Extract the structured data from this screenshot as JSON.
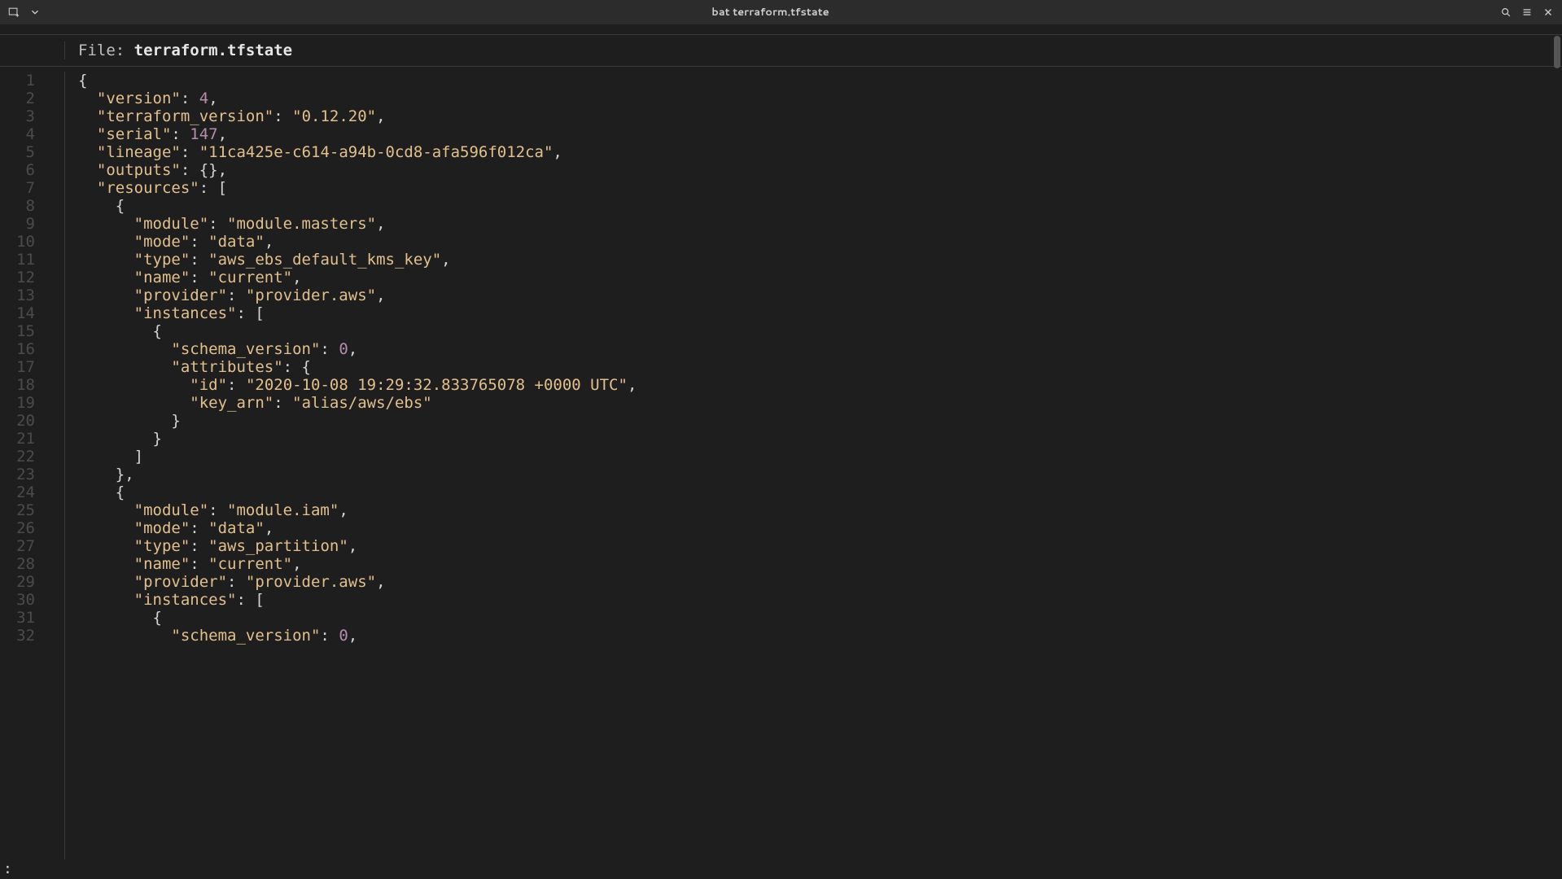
{
  "titlebar": {
    "title": "bat terraform.tfstate"
  },
  "file_header": {
    "prefix": "File: ",
    "filename": "terraform.tfstate"
  },
  "status": {
    "prompt": ":"
  },
  "code": {
    "lines": [
      {
        "n": 1,
        "tokens": [
          {
            "t": "{",
            "c": "p"
          }
        ]
      },
      {
        "n": 2,
        "tokens": [
          {
            "t": "  ",
            "c": "p"
          },
          {
            "t": "\"version\"",
            "c": "key"
          },
          {
            "t": ": ",
            "c": "p"
          },
          {
            "t": "4",
            "c": "num"
          },
          {
            "t": ",",
            "c": "p"
          }
        ]
      },
      {
        "n": 3,
        "tokens": [
          {
            "t": "  ",
            "c": "p"
          },
          {
            "t": "\"terraform_version\"",
            "c": "key"
          },
          {
            "t": ": ",
            "c": "p"
          },
          {
            "t": "\"0.12.20\"",
            "c": "str"
          },
          {
            "t": ",",
            "c": "p"
          }
        ]
      },
      {
        "n": 4,
        "tokens": [
          {
            "t": "  ",
            "c": "p"
          },
          {
            "t": "\"serial\"",
            "c": "key"
          },
          {
            "t": ": ",
            "c": "p"
          },
          {
            "t": "147",
            "c": "num"
          },
          {
            "t": ",",
            "c": "p"
          }
        ]
      },
      {
        "n": 5,
        "tokens": [
          {
            "t": "  ",
            "c": "p"
          },
          {
            "t": "\"lineage\"",
            "c": "key"
          },
          {
            "t": ": ",
            "c": "p"
          },
          {
            "t": "\"11ca425e-c614-a94b-0cd8-afa596f012ca\"",
            "c": "str"
          },
          {
            "t": ",",
            "c": "p"
          }
        ]
      },
      {
        "n": 6,
        "tokens": [
          {
            "t": "  ",
            "c": "p"
          },
          {
            "t": "\"outputs\"",
            "c": "key"
          },
          {
            "t": ": {},",
            "c": "p"
          }
        ]
      },
      {
        "n": 7,
        "tokens": [
          {
            "t": "  ",
            "c": "p"
          },
          {
            "t": "\"resources\"",
            "c": "key"
          },
          {
            "t": ": [",
            "c": "p"
          }
        ]
      },
      {
        "n": 8,
        "tokens": [
          {
            "t": "    {",
            "c": "p"
          }
        ]
      },
      {
        "n": 9,
        "tokens": [
          {
            "t": "      ",
            "c": "p"
          },
          {
            "t": "\"module\"",
            "c": "key"
          },
          {
            "t": ": ",
            "c": "p"
          },
          {
            "t": "\"module.masters\"",
            "c": "str"
          },
          {
            "t": ",",
            "c": "p"
          }
        ]
      },
      {
        "n": 10,
        "tokens": [
          {
            "t": "      ",
            "c": "p"
          },
          {
            "t": "\"mode\"",
            "c": "key"
          },
          {
            "t": ": ",
            "c": "p"
          },
          {
            "t": "\"data\"",
            "c": "str"
          },
          {
            "t": ",",
            "c": "p"
          }
        ]
      },
      {
        "n": 11,
        "tokens": [
          {
            "t": "      ",
            "c": "p"
          },
          {
            "t": "\"type\"",
            "c": "key"
          },
          {
            "t": ": ",
            "c": "p"
          },
          {
            "t": "\"aws_ebs_default_kms_key\"",
            "c": "str"
          },
          {
            "t": ",",
            "c": "p"
          }
        ]
      },
      {
        "n": 12,
        "tokens": [
          {
            "t": "      ",
            "c": "p"
          },
          {
            "t": "\"name\"",
            "c": "key"
          },
          {
            "t": ": ",
            "c": "p"
          },
          {
            "t": "\"current\"",
            "c": "str"
          },
          {
            "t": ",",
            "c": "p"
          }
        ]
      },
      {
        "n": 13,
        "tokens": [
          {
            "t": "      ",
            "c": "p"
          },
          {
            "t": "\"provider\"",
            "c": "key"
          },
          {
            "t": ": ",
            "c": "p"
          },
          {
            "t": "\"provider.aws\"",
            "c": "str"
          },
          {
            "t": ",",
            "c": "p"
          }
        ]
      },
      {
        "n": 14,
        "tokens": [
          {
            "t": "      ",
            "c": "p"
          },
          {
            "t": "\"instances\"",
            "c": "key"
          },
          {
            "t": ": [",
            "c": "p"
          }
        ]
      },
      {
        "n": 15,
        "tokens": [
          {
            "t": "        {",
            "c": "p"
          }
        ]
      },
      {
        "n": 16,
        "tokens": [
          {
            "t": "          ",
            "c": "p"
          },
          {
            "t": "\"schema_version\"",
            "c": "key"
          },
          {
            "t": ": ",
            "c": "p"
          },
          {
            "t": "0",
            "c": "num"
          },
          {
            "t": ",",
            "c": "p"
          }
        ]
      },
      {
        "n": 17,
        "tokens": [
          {
            "t": "          ",
            "c": "p"
          },
          {
            "t": "\"attributes\"",
            "c": "key"
          },
          {
            "t": ": {",
            "c": "p"
          }
        ]
      },
      {
        "n": 18,
        "tokens": [
          {
            "t": "            ",
            "c": "p"
          },
          {
            "t": "\"id\"",
            "c": "key"
          },
          {
            "t": ": ",
            "c": "p"
          },
          {
            "t": "\"2020-10-08 19:29:32.833765078 +0000 UTC\"",
            "c": "str"
          },
          {
            "t": ",",
            "c": "p"
          }
        ]
      },
      {
        "n": 19,
        "tokens": [
          {
            "t": "            ",
            "c": "p"
          },
          {
            "t": "\"key_arn\"",
            "c": "key"
          },
          {
            "t": ": ",
            "c": "p"
          },
          {
            "t": "\"alias/aws/ebs\"",
            "c": "str"
          }
        ]
      },
      {
        "n": 20,
        "tokens": [
          {
            "t": "          }",
            "c": "p"
          }
        ]
      },
      {
        "n": 21,
        "tokens": [
          {
            "t": "        }",
            "c": "p"
          }
        ]
      },
      {
        "n": 22,
        "tokens": [
          {
            "t": "      ]",
            "c": "p"
          }
        ]
      },
      {
        "n": 23,
        "tokens": [
          {
            "t": "    },",
            "c": "p"
          }
        ]
      },
      {
        "n": 24,
        "tokens": [
          {
            "t": "    {",
            "c": "p"
          }
        ]
      },
      {
        "n": 25,
        "tokens": [
          {
            "t": "      ",
            "c": "p"
          },
          {
            "t": "\"module\"",
            "c": "key"
          },
          {
            "t": ": ",
            "c": "p"
          },
          {
            "t": "\"module.iam\"",
            "c": "str"
          },
          {
            "t": ",",
            "c": "p"
          }
        ]
      },
      {
        "n": 26,
        "tokens": [
          {
            "t": "      ",
            "c": "p"
          },
          {
            "t": "\"mode\"",
            "c": "key"
          },
          {
            "t": ": ",
            "c": "p"
          },
          {
            "t": "\"data\"",
            "c": "str"
          },
          {
            "t": ",",
            "c": "p"
          }
        ]
      },
      {
        "n": 27,
        "tokens": [
          {
            "t": "      ",
            "c": "p"
          },
          {
            "t": "\"type\"",
            "c": "key"
          },
          {
            "t": ": ",
            "c": "p"
          },
          {
            "t": "\"aws_partition\"",
            "c": "str"
          },
          {
            "t": ",",
            "c": "p"
          }
        ]
      },
      {
        "n": 28,
        "tokens": [
          {
            "t": "      ",
            "c": "p"
          },
          {
            "t": "\"name\"",
            "c": "key"
          },
          {
            "t": ": ",
            "c": "p"
          },
          {
            "t": "\"current\"",
            "c": "str"
          },
          {
            "t": ",",
            "c": "p"
          }
        ]
      },
      {
        "n": 29,
        "tokens": [
          {
            "t": "      ",
            "c": "p"
          },
          {
            "t": "\"provider\"",
            "c": "key"
          },
          {
            "t": ": ",
            "c": "p"
          },
          {
            "t": "\"provider.aws\"",
            "c": "str"
          },
          {
            "t": ",",
            "c": "p"
          }
        ]
      },
      {
        "n": 30,
        "tokens": [
          {
            "t": "      ",
            "c": "p"
          },
          {
            "t": "\"instances\"",
            "c": "key"
          },
          {
            "t": ": [",
            "c": "p"
          }
        ]
      },
      {
        "n": 31,
        "tokens": [
          {
            "t": "        {",
            "c": "p"
          }
        ]
      },
      {
        "n": 32,
        "tokens": [
          {
            "t": "          ",
            "c": "p"
          },
          {
            "t": "\"schema_version\"",
            "c": "key"
          },
          {
            "t": ": ",
            "c": "p"
          },
          {
            "t": "0",
            "c": "num"
          },
          {
            "t": ",",
            "c": "p"
          }
        ]
      }
    ]
  }
}
